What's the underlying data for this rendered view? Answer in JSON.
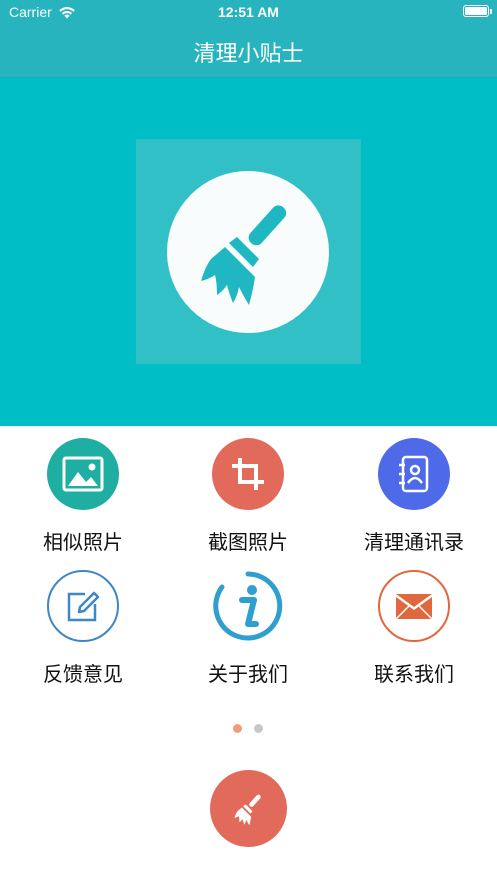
{
  "status_bar": {
    "carrier": "Carrier",
    "time": "12:51 AM"
  },
  "nav": {
    "title": "清理小贴士"
  },
  "menu": {
    "items": [
      {
        "label": "相似照片",
        "icon": "image-icon",
        "color": "#1faea2"
      },
      {
        "label": "截图照片",
        "icon": "crop-icon",
        "color": "#e26a5b"
      },
      {
        "label": "清理通讯录",
        "icon": "contacts-book-icon",
        "color": "#4f6ae8"
      },
      {
        "label": "反馈意见",
        "icon": "edit-icon",
        "color": "#3f86c4"
      },
      {
        "label": "关于我们",
        "icon": "info-icon",
        "color": "#2f9fd0"
      },
      {
        "label": "联系我们",
        "icon": "mail-icon",
        "color": "#e0683e"
      }
    ]
  },
  "pager": {
    "pages": 2,
    "current": 1,
    "active_color": "#f29a7c",
    "inactive_color": "#c8c8c8"
  },
  "colors": {
    "nav_bar": "#27b4bf",
    "hero": "#00bec6",
    "fab": "#e26a5b"
  }
}
